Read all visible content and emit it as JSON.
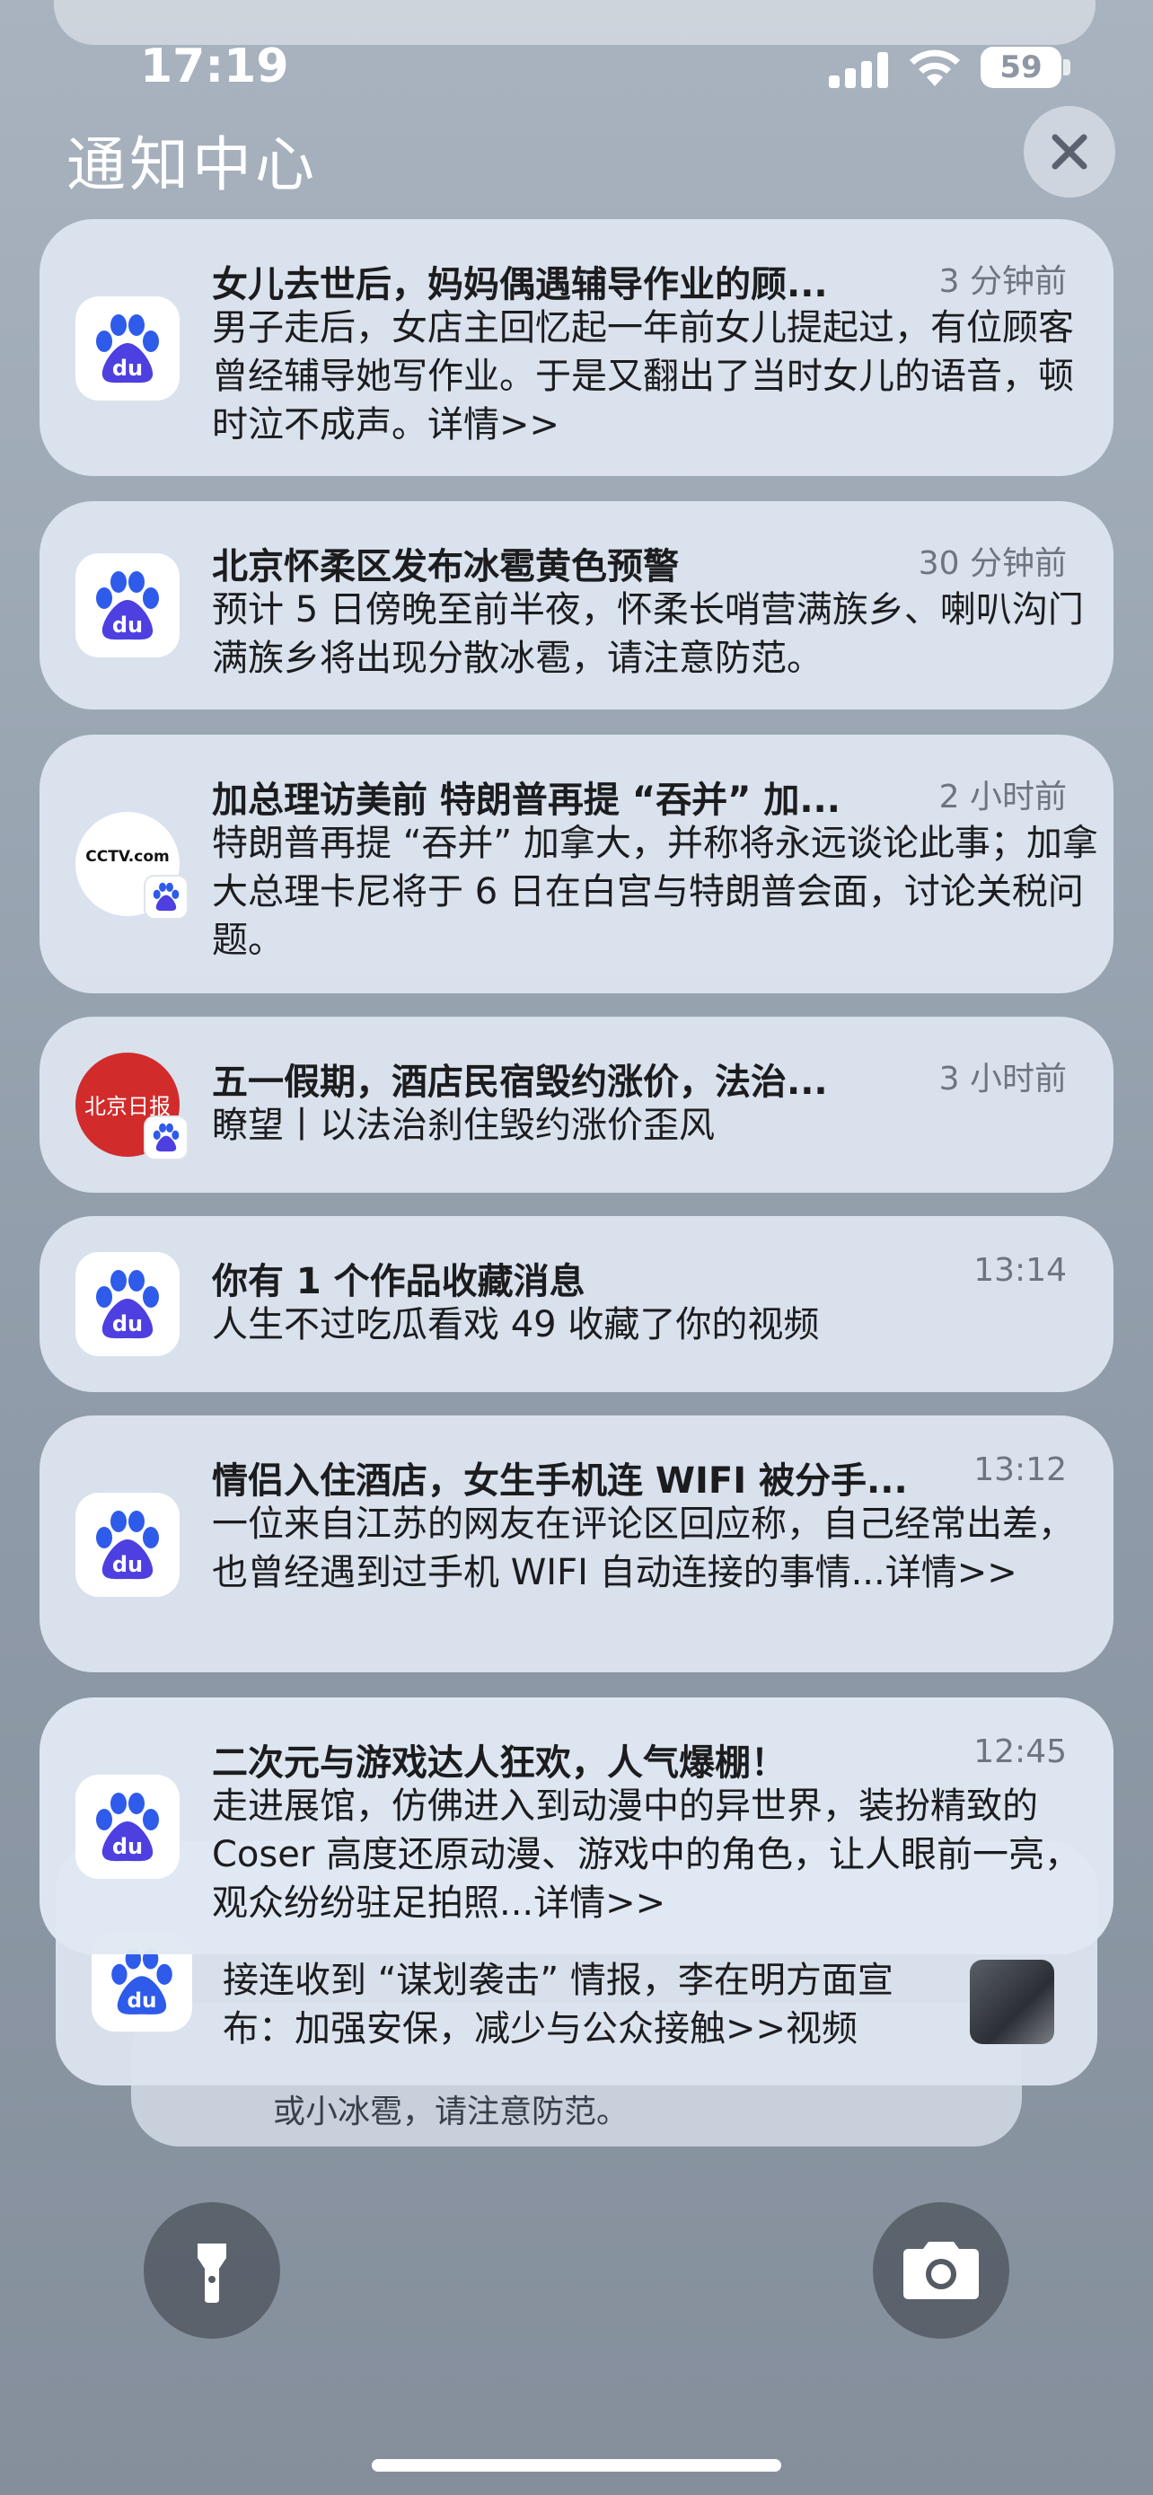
{
  "status_bar": {
    "time": "17:19",
    "battery": "59"
  },
  "header": {
    "title": "通知中心"
  },
  "icons": {
    "baidu": "baidu-paw-icon",
    "cctv": "cctv-logo-icon",
    "bjrb": "beijing-daily-logo-icon",
    "flashlight": "flashlight-icon",
    "camera": "camera-icon",
    "close": "close-icon"
  },
  "colors": {
    "baidu_blue": "#2f5bea",
    "baidu_purple": "#6a4ee8",
    "bjrb_red": "#d22b2b"
  },
  "notifications": [
    {
      "title": "女儿去世后，妈妈偶遇辅导作业的顾...",
      "time": "3 分钟前",
      "body": "男子走后，女店主回忆起一年前女儿提起过，有位顾客曾经辅导她写作业。于是又翻出了当时女儿的语音，顿时泣不成声。详情>>"
    },
    {
      "title": "北京怀柔区发布冰雹黄色预警",
      "time": "30 分钟前",
      "body": "预计 5 日傍晚至前半夜，怀柔长哨营满族乡、喇叭沟门满族乡将出现分散冰雹，请注意防范。"
    },
    {
      "title": "加总理访美前 特朗普再提 “吞并” 加...",
      "time": "2 小时前",
      "body": "特朗普再提 “吞并” 加拿大，并称将永远谈论此事；加拿大总理卡尼将于 6 日在白宫与特朗普会面，讨论关税问题。",
      "logo_text": "CCTV.com"
    },
    {
      "title": "五一假期，酒店民宿毁约涨价，法治...",
      "time": "3 小时前",
      "body": "瞭望丨以法治刹住毁约涨价歪风",
      "logo_text": "北京日报"
    },
    {
      "title": "你有 1 个作品收藏消息",
      "time": "13:14",
      "body": "人生不过吃瓜看戏 49 收藏了你的视频"
    },
    {
      "title": "情侣入住酒店，女生手机连 WIFI 被分手...",
      "time": "13:12",
      "body": "一位来自江苏的网友在评论区回应称，自己经常出差，也曾经遇到过手机 WIFI 自动连接的事情...详情>>"
    },
    {
      "title": "二次元与游戏达人狂欢，人气爆棚！",
      "time": "12:45",
      "body": "走进展馆，仿佛进入到动漫中的异世界，装扮精致的 Coser 高度还原动漫、游戏中的角色，让人眼前一亮，观众纷纷驻足拍照...详情>>"
    }
  ],
  "stacked": {
    "body": "接连收到 “谋划袭击” 情报，李在明方面宣布：加强安保，减少与公众接触>>视频",
    "behind_text": "或小冰雹，请注意防范。"
  }
}
